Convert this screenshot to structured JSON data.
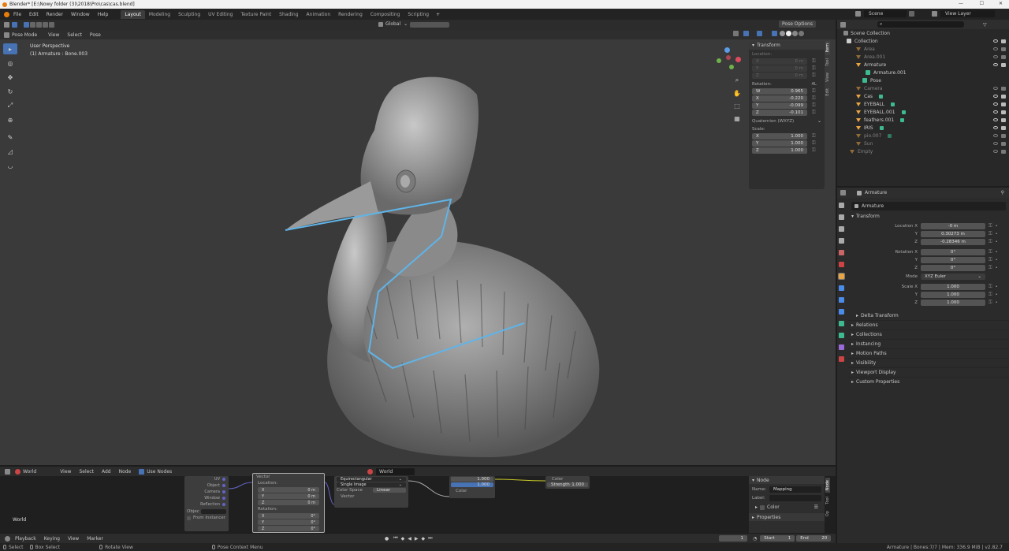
{
  "titlebar": {
    "title": "Blender* [E:\\Nowy folder (3)\\2018\\Pro\\cas\\cas.blend]"
  },
  "menu": [
    "File",
    "Edit",
    "Render",
    "Window",
    "Help"
  ],
  "workspaces": [
    "Layout",
    "Modeling",
    "Sculpting",
    "UV Editing",
    "Texture Paint",
    "Shading",
    "Animation",
    "Rendering",
    "Compositing",
    "Scripting"
  ],
  "workspace_plus": "+",
  "scene": {
    "name": "Scene",
    "view_layer": "View Layer"
  },
  "viewport": {
    "mode": "Pose Mode",
    "menus": [
      "View",
      "Select",
      "Pose"
    ],
    "orientation": "Global",
    "pose_options": "Pose Options",
    "perspective": "User Perspective",
    "context": "(1) Armature : Bone.003",
    "tabs": [
      "Item",
      "Tool",
      "View",
      "Edit"
    ]
  },
  "transform_panel": {
    "header": "Transform",
    "location_label": "Location:",
    "location": [
      {
        "axis": "X",
        "value": "0 m"
      },
      {
        "axis": "Y",
        "value": "0 m"
      },
      {
        "axis": "Z",
        "value": "0 m"
      }
    ],
    "rotation_label": "Rotation:",
    "rotation_mode_short": "4L",
    "rotation": [
      {
        "axis": "W",
        "value": "0.965"
      },
      {
        "axis": "X",
        "value": "-0.220"
      },
      {
        "axis": "Y",
        "value": "-0.099"
      },
      {
        "axis": "Z",
        "value": "-0.101"
      }
    ],
    "rotation_mode": "Quaternion (WXYZ)",
    "scale_label": "Scale:",
    "scale": [
      {
        "axis": "X",
        "value": "1.000"
      },
      {
        "axis": "Y",
        "value": "1.000"
      },
      {
        "axis": "Z",
        "value": "1.000"
      }
    ]
  },
  "outliner": {
    "root": "Scene Collection",
    "items": [
      {
        "name": "Collection",
        "type": "collection"
      },
      {
        "name": "Area",
        "type": "light"
      },
      {
        "name": "Area.001",
        "type": "light"
      },
      {
        "name": "Armature",
        "type": "armature"
      },
      {
        "name": "Armature.001",
        "type": "data"
      },
      {
        "name": "Pose",
        "type": "pose"
      },
      {
        "name": "Camera",
        "type": "camera"
      },
      {
        "name": "Cas",
        "type": "mesh"
      },
      {
        "name": "EYEBALL",
        "type": "mesh"
      },
      {
        "name": "EYEBALL.001",
        "type": "mesh"
      },
      {
        "name": "feathers.001",
        "type": "mesh"
      },
      {
        "name": "IRIS",
        "type": "mesh"
      },
      {
        "name": "pio.007",
        "type": "mesh"
      },
      {
        "name": "Sun",
        "type": "light"
      },
      {
        "name": "Empty",
        "type": "empty"
      }
    ]
  },
  "properties": {
    "object": "Armature",
    "name_field": "Armature",
    "transform_header": "Transform",
    "location_label": "Location X",
    "location": [
      {
        "axis": "",
        "value": "-0 m"
      },
      {
        "axis": "Y",
        "value": "0.30273 m"
      },
      {
        "axis": "Z",
        "value": "-0.28346 m"
      }
    ],
    "rotation_label": "Rotation X",
    "rotation": [
      {
        "axis": "",
        "value": "0°"
      },
      {
        "axis": "Y",
        "value": "0°"
      },
      {
        "axis": "Z",
        "value": "0°"
      }
    ],
    "mode_label": "Mode",
    "mode_value": "XYZ Euler",
    "scale_label": "Scale X",
    "scale": [
      {
        "axis": "",
        "value": "1.000"
      },
      {
        "axis": "Y",
        "value": "1.000"
      },
      {
        "axis": "Z",
        "value": "1.000"
      }
    ],
    "delta": "Delta Transform",
    "sections": [
      "Relations",
      "Collections",
      "Instancing",
      "Motion Paths",
      "Visibility",
      "Viewport Display",
      "Custom Properties"
    ]
  },
  "node_editor": {
    "type": "World",
    "menus": [
      "View",
      "Select",
      "Add",
      "Node"
    ],
    "use_nodes": "Use Nodes",
    "world_name": "World",
    "corner_label": "World",
    "texcoord_outputs": [
      "UV",
      "Object",
      "Camera",
      "Window",
      "Reflection"
    ],
    "texcoord_object": "Objec",
    "texcoord_from_instancer": "From Instancer",
    "mapping_vector": "Vector",
    "mapping_location": "Location:",
    "mapping_loc": [
      {
        "axis": "X",
        "value": "0 m"
      },
      {
        "axis": "Y",
        "value": "0 m"
      },
      {
        "axis": "Z",
        "value": "0 m"
      }
    ],
    "mapping_rotation": "Rotation:",
    "mapping_rot": [
      {
        "axis": "X",
        "value": "0°"
      },
      {
        "axis": "Y",
        "value": "0°"
      },
      {
        "axis": "Z",
        "value": "0°"
      }
    ],
    "image_opts": [
      "Equirectangular",
      "Single Image"
    ],
    "image_colorspace_label": "Color Space",
    "image_colorspace": "Linear",
    "image_vector": "Vector",
    "ramp_pos": "1.000",
    "ramp_val": "1.000",
    "ramp_color": "Color",
    "bg_strength_label": "Strength",
    "bg_strength": "1.000",
    "bg_color": "Color",
    "side_header": "Node",
    "side_name_label": "Name:",
    "side_name": "Mapping",
    "side_label_label": "Label:",
    "side_color": "Color",
    "side_properties": "Properties",
    "tabs": [
      "Node",
      "Tool",
      "Op"
    ]
  },
  "timeline": {
    "menus": [
      "Playback",
      "Keying",
      "View",
      "Marker"
    ],
    "frame": "1",
    "start_label": "Start",
    "start": "1",
    "end_label": "End",
    "end": "20"
  },
  "statusbar": {
    "left": [
      "Select",
      "Box Select",
      "Rotate View",
      "Pose Context Menu"
    ],
    "right": "Armature | Bones:7/7 | Mem: 336.9 MiB | v2.82.7"
  },
  "colors": {
    "accent": "#4772b3",
    "bone": "#5fb4e8",
    "panel": "#303030",
    "header": "#232323"
  }
}
